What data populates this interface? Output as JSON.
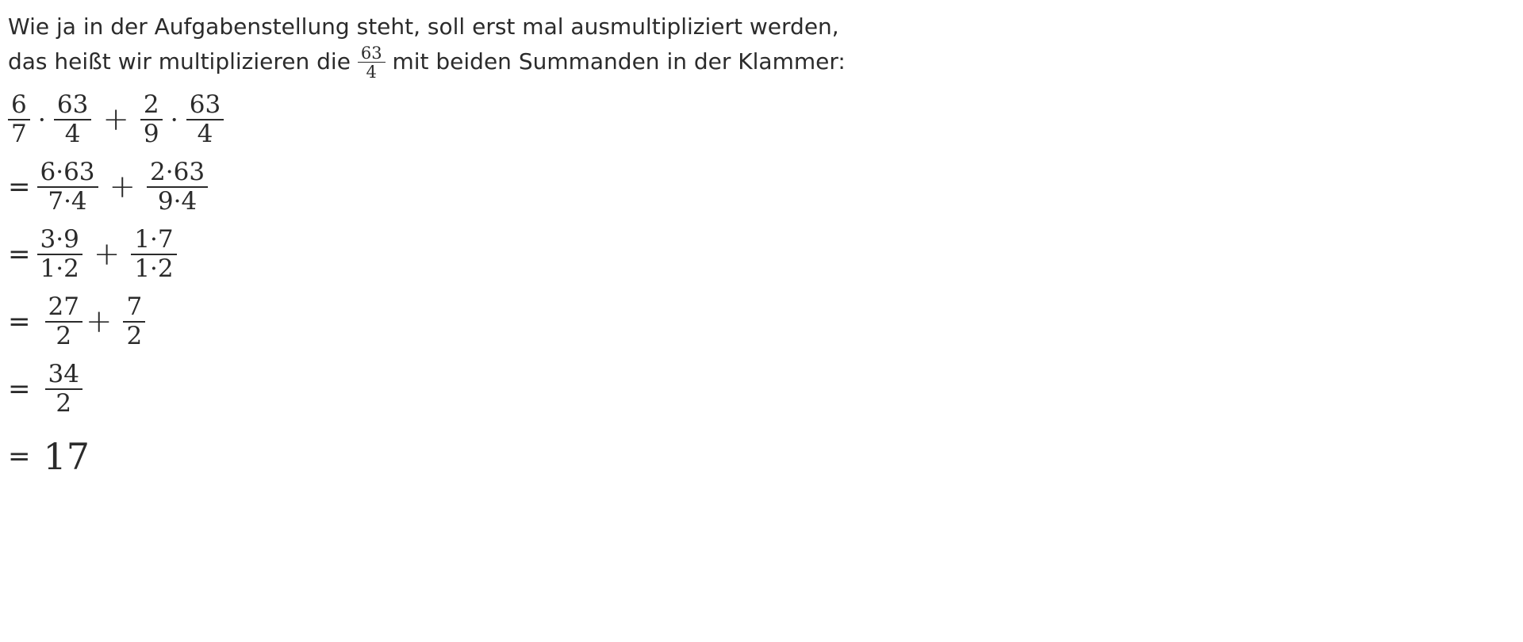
{
  "intro": {
    "line1": "Wie ja in der Aufgabenstellung steht, soll erst mal ausmultipliziert werden,",
    "line2_before": "das heißt wir multiplizieren die",
    "line2_frac_num": "63",
    "line2_frac_den": "4",
    "line2_after": "mit beiden Summanden in der Klammer:"
  },
  "steps": {
    "s1": {
      "a_num": "6",
      "a_den": "7",
      "dot1": "·",
      "b_num": "63",
      "b_den": "4",
      "plus": "+",
      "c_num": "2",
      "c_den": "9",
      "dot2": "·",
      "d_num": "63",
      "d_den": "4"
    },
    "s2": {
      "eq": "=",
      "a_num": "6·63",
      "a_den": "7·4",
      "plus": "+",
      "b_num": "2·63",
      "b_den": "9·4"
    },
    "s3": {
      "eq": "=",
      "a_num": "3·9",
      "a_den": "1·2",
      "plus": "+",
      "b_num": "1·7",
      "b_den": "1·2"
    },
    "s4": {
      "eq": "=",
      "a_num": "27",
      "a_den": "2",
      "plus": "+",
      "b_num": "7",
      "b_den": "2"
    },
    "s5": {
      "eq": "=",
      "a_num": "34",
      "a_den": "2"
    },
    "s6": {
      "eq": "=",
      "result": "17"
    }
  }
}
